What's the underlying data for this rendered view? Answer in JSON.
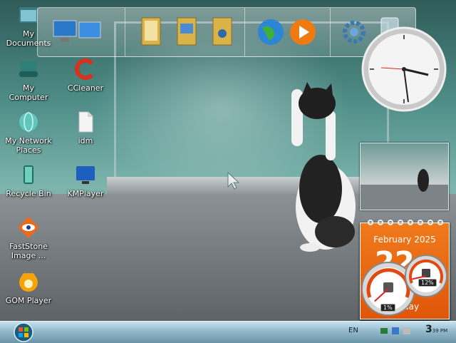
{
  "desktop": {
    "icons": [
      {
        "label": "My\nDocuments",
        "icon": "folder-documents-icon"
      },
      {
        "label": "My\nComputer",
        "icon": "computer-icon"
      },
      {
        "label": "My Network\nPlaces",
        "icon": "network-globe-icon"
      },
      {
        "label": "Recycle Bin",
        "icon": "recycle-bin-icon"
      },
      {
        "label": "FastStone\nImage ...",
        "icon": "faststone-eye-icon"
      },
      {
        "label": "GOM Player",
        "icon": "gom-player-icon"
      },
      {
        "label": "CCleaner",
        "icon": "ccleaner-icon"
      },
      {
        "label": "idm",
        "icon": "file-icon"
      },
      {
        "label": "KMPlayer",
        "icon": "kmplayer-icon"
      }
    ]
  },
  "dock": {
    "items": [
      {
        "icon": "network-computers-icon"
      },
      {
        "icon": "documents-folder-icon"
      },
      {
        "icon": "pictures-folder-icon"
      },
      {
        "icon": "music-folder-icon"
      },
      {
        "icon": "internet-globe-icon"
      },
      {
        "icon": "media-player-icon"
      },
      {
        "icon": "settings-gear-icon"
      },
      {
        "icon": "recycle-bin-icon"
      }
    ]
  },
  "gadgets": {
    "calendar": {
      "month": "February 2025",
      "day": "22",
      "weekday": "day"
    },
    "cpu_gauge": {
      "readout": "1%",
      "level": 0.01
    },
    "memory_gauge": {
      "readout": "12%",
      "level": 0.12
    }
  },
  "taskbar": {
    "language": "EN",
    "time": "3",
    "time_minutes": "39",
    "ampm": "PM"
  },
  "colors": {
    "calendar": "#e8650f",
    "taskbar": "#9fc3d4"
  }
}
